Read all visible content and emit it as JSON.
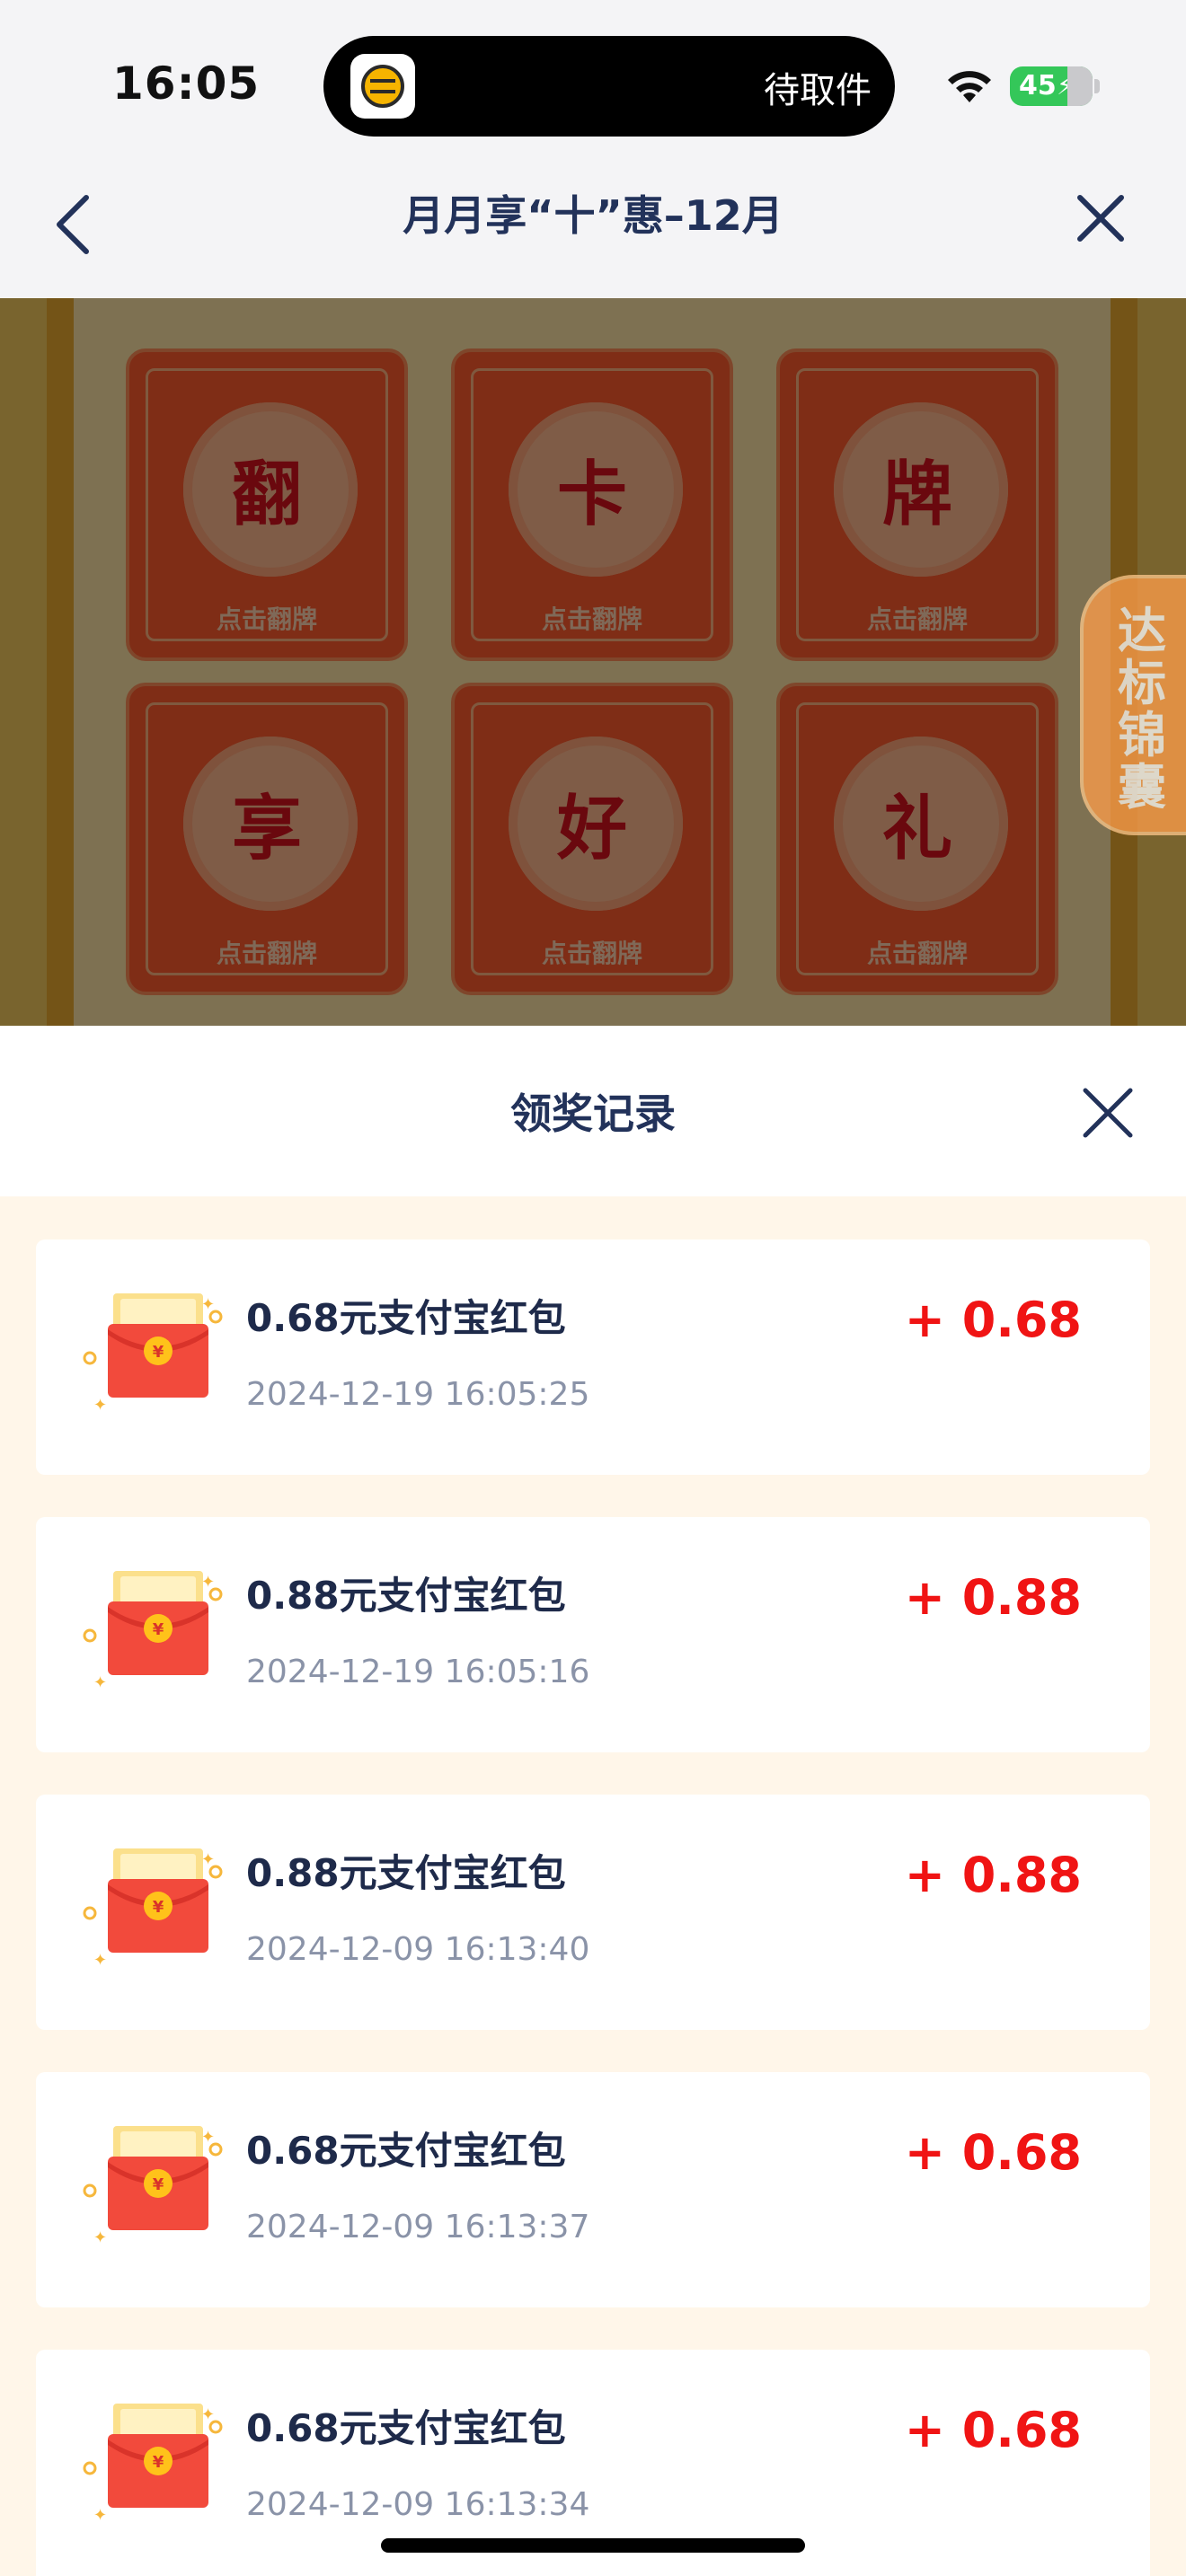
{
  "status_bar": {
    "time": "16:05",
    "island_text": "待取件",
    "battery": "45",
    "icons": [
      "wifi-icon",
      "battery-icon",
      "package-app-icon"
    ]
  },
  "nav": {
    "title": "月月享“十”惠–12月",
    "back_icon": "chevron-left-icon",
    "close_icon": "close-icon"
  },
  "game": {
    "cards": [
      {
        "char": "翻",
        "hint": "点击翻牌"
      },
      {
        "char": "卡",
        "hint": "点击翻牌"
      },
      {
        "char": "牌",
        "hint": "点击翻牌"
      },
      {
        "char": "享",
        "hint": "点击翻牌"
      },
      {
        "char": "好",
        "hint": "点击翻牌"
      },
      {
        "char": "礼",
        "hint": "点击翻牌"
      }
    ],
    "side_tab": "达标锦囊"
  },
  "sheet": {
    "title": "领奖记录",
    "close_icon": "close-icon",
    "records": [
      {
        "title": "0.68元支付宝红包",
        "time": "2024-12-19 16:05:25",
        "amount": "+ 0.68"
      },
      {
        "title": "0.88元支付宝红包",
        "time": "2024-12-19 16:05:16",
        "amount": "+ 0.88"
      },
      {
        "title": "0.88元支付宝红包",
        "time": "2024-12-09 16:13:40",
        "amount": "+ 0.88"
      },
      {
        "title": "0.68元支付宝红包",
        "time": "2024-12-09 16:13:37",
        "amount": "+ 0.68"
      },
      {
        "title": "0.68元支付宝红包",
        "time": "2024-12-09 16:13:34",
        "amount": "+ 0.68"
      }
    ]
  },
  "colors": {
    "amount": "#f01414",
    "title": "#22325a",
    "sheet_bg": "#fff6e9",
    "card": "#ff5a2c"
  }
}
